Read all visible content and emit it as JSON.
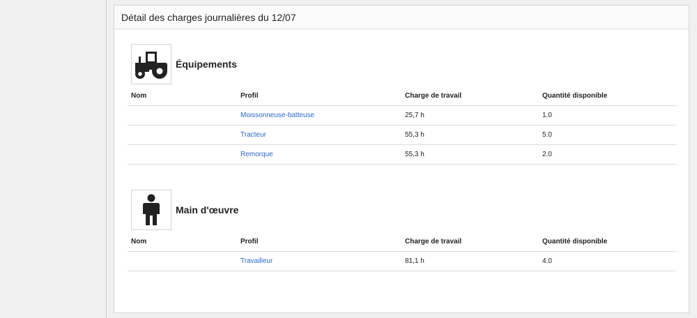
{
  "panel": {
    "title": "Détail des charges journalières du 12/07"
  },
  "columns": [
    "Nom",
    "Profil",
    "Charge de travail",
    "Quantité disponible"
  ],
  "sections": [
    {
      "title": "Équipements",
      "icon": "tractor-icon",
      "rows": [
        {
          "nom": "",
          "profil": "Moissonneuse-batteuse",
          "charge": "25,7 h",
          "quantite": "1.0"
        },
        {
          "nom": "",
          "profil": "Tracteur",
          "charge": "55,3 h",
          "quantite": "5.0"
        },
        {
          "nom": "",
          "profil": "Remorque",
          "charge": "55,3 h",
          "quantite": "2.0"
        }
      ]
    },
    {
      "title": "Main d'œuvre",
      "icon": "person-icon",
      "rows": [
        {
          "nom": "",
          "profil": "Travailleur",
          "charge": "81,1 h",
          "quantite": "4.0"
        }
      ]
    }
  ]
}
